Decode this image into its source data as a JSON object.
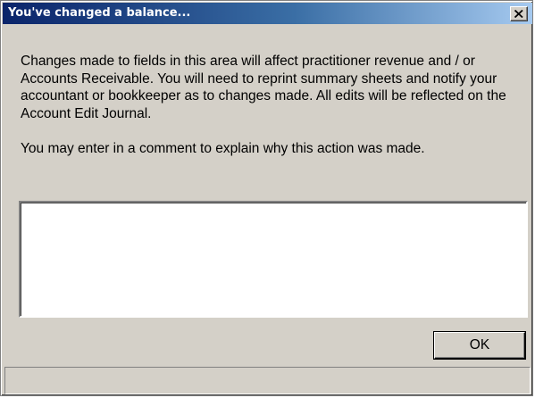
{
  "window": {
    "title": "You've changed a balance...",
    "close_icon": "close-icon"
  },
  "message": {
    "paragraph1": "Changes made to fields in this area will affect practitioner revenue and / or Accounts Receivable. You will need to reprint summary sheets and notify your accountant or bookkeeper as to changes made. All edits will be reflected on the Account Edit Journal.",
    "paragraph2": "You may enter in a comment to explain why this action was made."
  },
  "comment": {
    "value": ""
  },
  "buttons": {
    "ok_label": "OK"
  },
  "status_bar": {
    "text": ""
  },
  "colors": {
    "title_gradient_start": "#0a246a",
    "title_gradient_end": "#a6caf0",
    "dialog_face": "#d4d0c8"
  }
}
